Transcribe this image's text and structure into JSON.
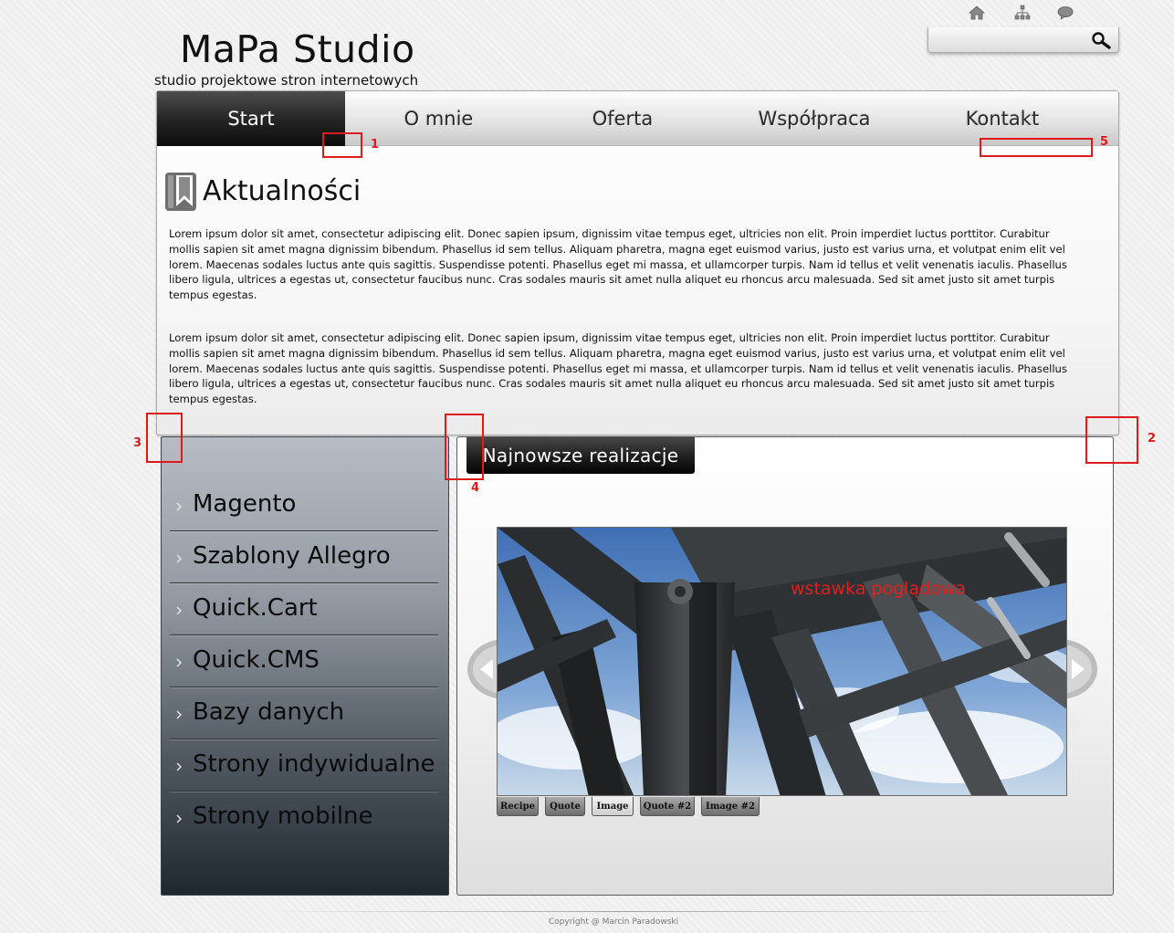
{
  "header": {
    "title": "MaPa Studio",
    "subtitle": "studio projektowe stron internetowych",
    "utility_icons": [
      "home-icon",
      "sitemap-icon",
      "speech-bubble-icon"
    ],
    "search": {
      "value": "",
      "placeholder": ""
    }
  },
  "nav": {
    "items": [
      {
        "label": "Start",
        "active": true
      },
      {
        "label": "O mnie"
      },
      {
        "label": "Oferta"
      },
      {
        "label": "Współpraca"
      },
      {
        "label": "Kontakt"
      }
    ]
  },
  "news": {
    "title": "Aktualności",
    "paragraphs": [
      "Lorem ipsum dolor sit amet, consectetur adipiscing elit. Donec sapien ipsum, dignissim vitae tempus eget, ultricies non elit. Proin imperdiet luctus porttitor. Curabitur mollis sapien sit amet magna dignissim bibendum. Phasellus id sem tellus. Aliquam pharetra, magna eget euismod varius, justo est varius urna, et volutpat enim elit vel lorem. Maecenas sodales luctus ante quis sagittis. Suspendisse potenti. Phasellus eget mi massa, et ullamcorper turpis. Nam id tellus et velit venenatis iaculis. Phasellus libero ligula, ultrices a egestas ut, consectetur faucibus nunc. Cras sodales mauris sit amet nulla aliquet eu rhoncus arcu malesuada. Sed sit amet justo sit amet turpis tempus egestas.",
      "Lorem ipsum dolor sit amet, consectetur adipiscing elit. Donec sapien ipsum, dignissim vitae tempus eget, ultricies non elit. Proin imperdiet luctus porttitor. Curabitur mollis sapien sit amet magna dignissim bibendum. Phasellus id sem tellus. Aliquam pharetra, magna eget euismod varius, justo est varius urna, et volutpat enim elit vel lorem. Maecenas sodales luctus ante quis sagittis. Suspendisse potenti. Phasellus eget mi massa, et ullamcorper turpis. Nam id tellus et velit venenatis iaculis. Phasellus libero ligula, ultrices a egestas ut, consectetur faucibus nunc. Cras sodales mauris sit amet nulla aliquet eu rhoncus arcu malesuada. Sed sit amet justo sit amet turpis tempus egestas."
    ]
  },
  "sidebar": {
    "items": [
      {
        "label": "Magento"
      },
      {
        "label": "Szablony Allegro"
      },
      {
        "label": "Quick.Cart"
      },
      {
        "label": "Quick.CMS"
      },
      {
        "label": "Bazy danych"
      },
      {
        "label": "Strony indywidualne"
      },
      {
        "label": "Strony mobilne"
      }
    ]
  },
  "projects": {
    "title": "Najnowsze realizacje",
    "slide_caption": "wstawka poglądowa",
    "tabs": [
      {
        "label": "Recipe"
      },
      {
        "label": "Quote"
      },
      {
        "label": "Image",
        "active": true
      },
      {
        "label": "Quote #2"
      },
      {
        "label": "Image #2"
      }
    ]
  },
  "annotations": [
    "1",
    "2",
    "3",
    "4",
    "5"
  ],
  "colors": {
    "annotation": "#e01a1a",
    "caption": "#e02020",
    "nav_active": "#1e1e1e"
  },
  "footer": {
    "copyright": "Copyright @ Marcin Paradowski"
  }
}
